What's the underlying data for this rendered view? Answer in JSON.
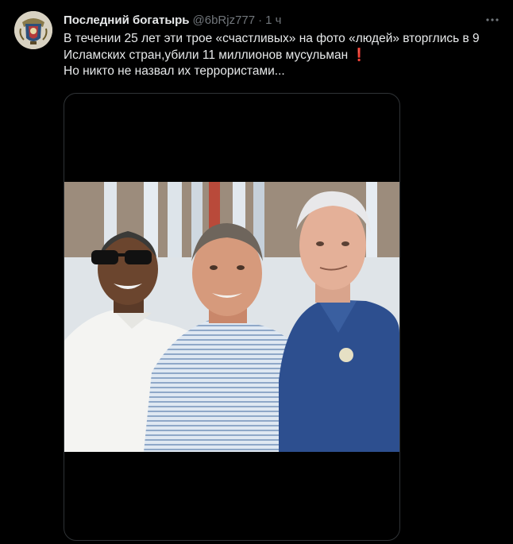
{
  "author": {
    "name": "Последний богатырь",
    "handle": "@6bRjz777",
    "separator": "·",
    "time": "1 ч"
  },
  "tweet": {
    "line1": "В течении 25 лет эти трое «счастливых» на фото «людей» вторглись в 9 Исламских стран,убили 11 миллионов мусульман",
    "emoji": "❗",
    "line2": "Но никто не назвал их террористами..."
  },
  "icons": {
    "more": "more-horizontal-icon",
    "avatar": "coat-of-arms-avatar"
  },
  "colors": {
    "background": "#000000",
    "text": "#e7e9ea",
    "muted": "#71767b",
    "border": "#2f3336",
    "emoji_red": "#e0245e"
  }
}
